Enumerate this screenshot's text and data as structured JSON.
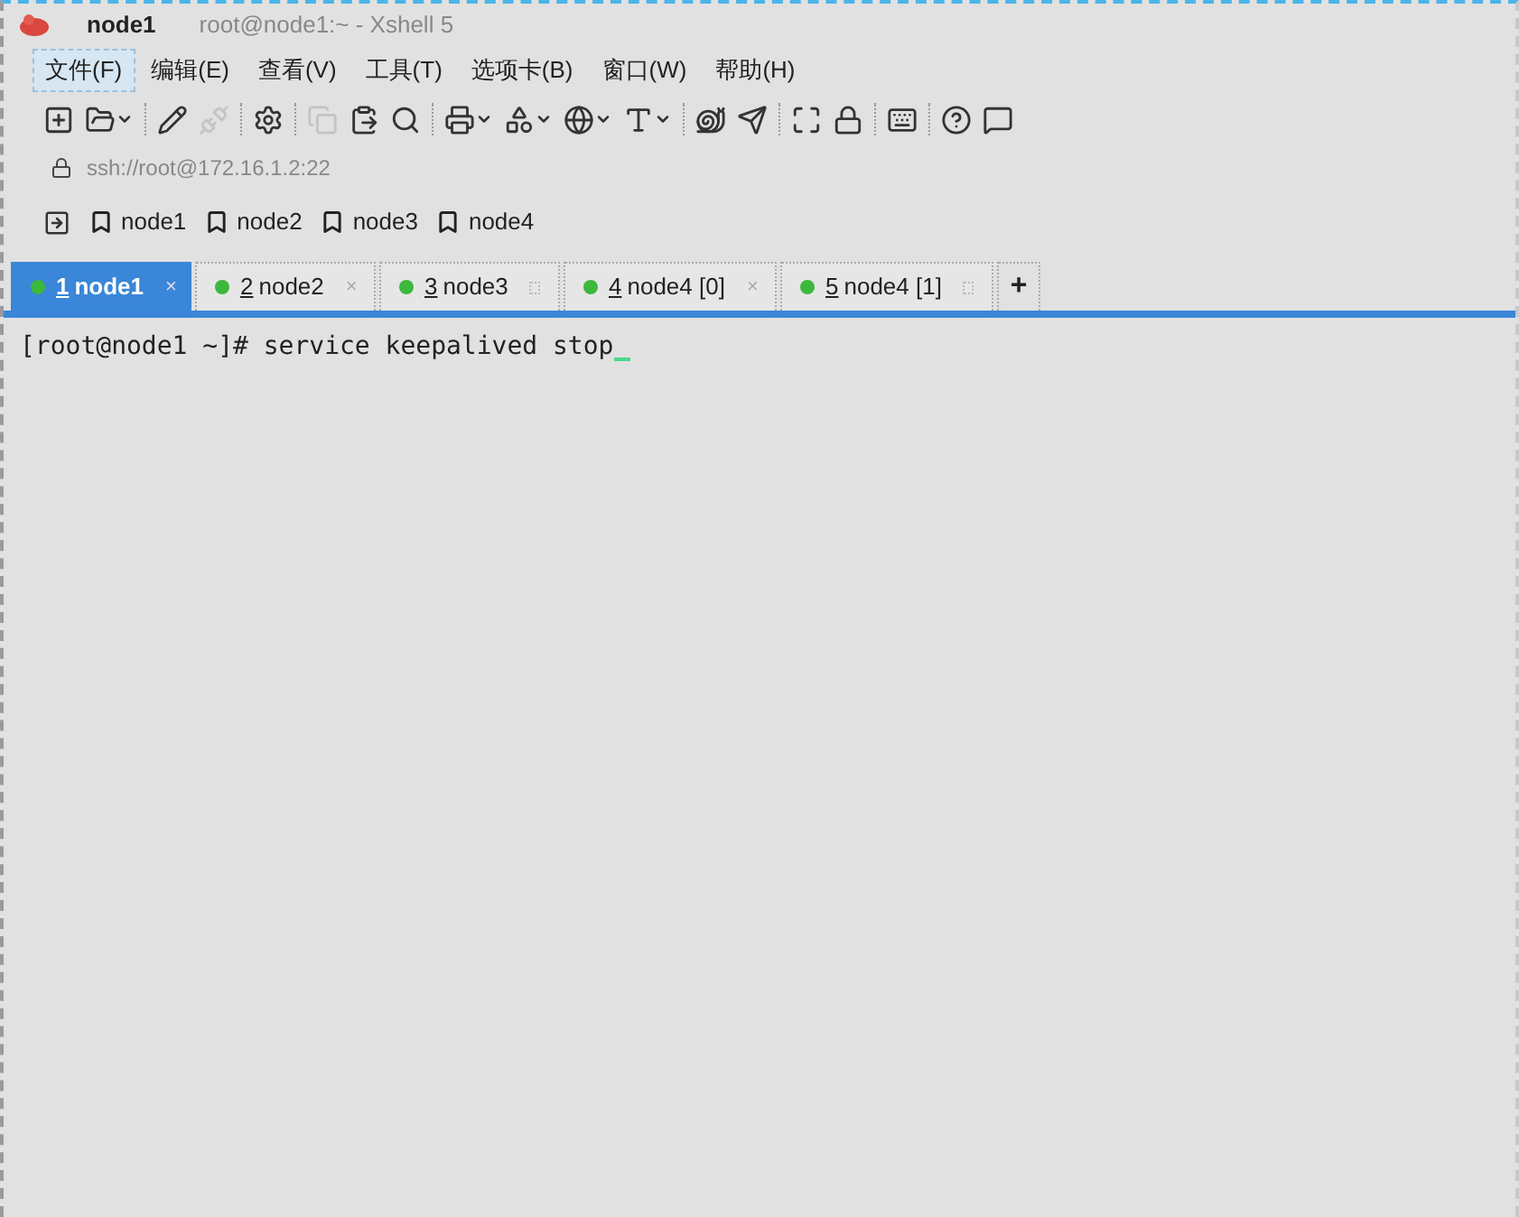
{
  "window": {
    "title": "node1",
    "subtitle": "root@node1:~ - Xshell 5"
  },
  "menu": [
    {
      "label": "文件(F)",
      "selected": true
    },
    {
      "label": "编辑(E)",
      "selected": false
    },
    {
      "label": "查看(V)",
      "selected": false
    },
    {
      "label": "工具(T)",
      "selected": false
    },
    {
      "label": "选项卡(B)",
      "selected": false
    },
    {
      "label": "窗口(W)",
      "selected": false
    },
    {
      "label": "帮助(H)",
      "selected": false
    }
  ],
  "toolbar": {
    "groups": [
      {
        "buttons": [
          {
            "disabled": false
          },
          {
            "disabled": false
          }
        ]
      },
      {
        "buttons": [
          {
            "disabled": false
          },
          {
            "disabled": true
          }
        ]
      },
      {
        "buttons": [
          {
            "disabled": false
          }
        ]
      },
      {
        "buttons": [
          {
            "disabled": true
          },
          {
            "disabled": false
          },
          {
            "disabled": false
          }
        ]
      },
      {
        "buttons": [
          {
            "disabled": false
          },
          {
            "disabled": false
          },
          {
            "disabled": false
          },
          {
            "disabled": false
          }
        ]
      },
      {
        "buttons": [
          {
            "disabled": false
          },
          {
            "disabled": false
          }
        ]
      },
      {
        "buttons": [
          {
            "disabled": false
          },
          {
            "disabled": false
          }
        ]
      },
      {
        "buttons": [
          {
            "disabled": false
          }
        ]
      },
      {
        "buttons": [
          {
            "disabled": false
          },
          {
            "disabled": false
          }
        ]
      }
    ]
  },
  "address": "ssh://root@172.16.1.2:22",
  "quick_commands": [
    "node1",
    "node2",
    "node3",
    "node4"
  ],
  "tabs": [
    {
      "number": "1",
      "label": "node1",
      "selected": true,
      "color": "#3cb83c",
      "close": "×"
    },
    {
      "number": "2",
      "label": "node2",
      "selected": false,
      "color": "#3cb83c",
      "close": "×"
    },
    {
      "number": "3",
      "label": "node3",
      "selected": false,
      "color": "#3cb83c"
    },
    {
      "number": "4",
      "label": "node4 [0]",
      "selected": false,
      "color": "#3cb83c",
      "close": "×"
    },
    {
      "number": "5",
      "label": "node4 [1]",
      "selected": false,
      "color": "#3cb83c"
    }
  ],
  "new_tab": "+",
  "terminal": {
    "lines": [
      "[root@node1 ~]# service keepalived stop"
    ]
  }
}
